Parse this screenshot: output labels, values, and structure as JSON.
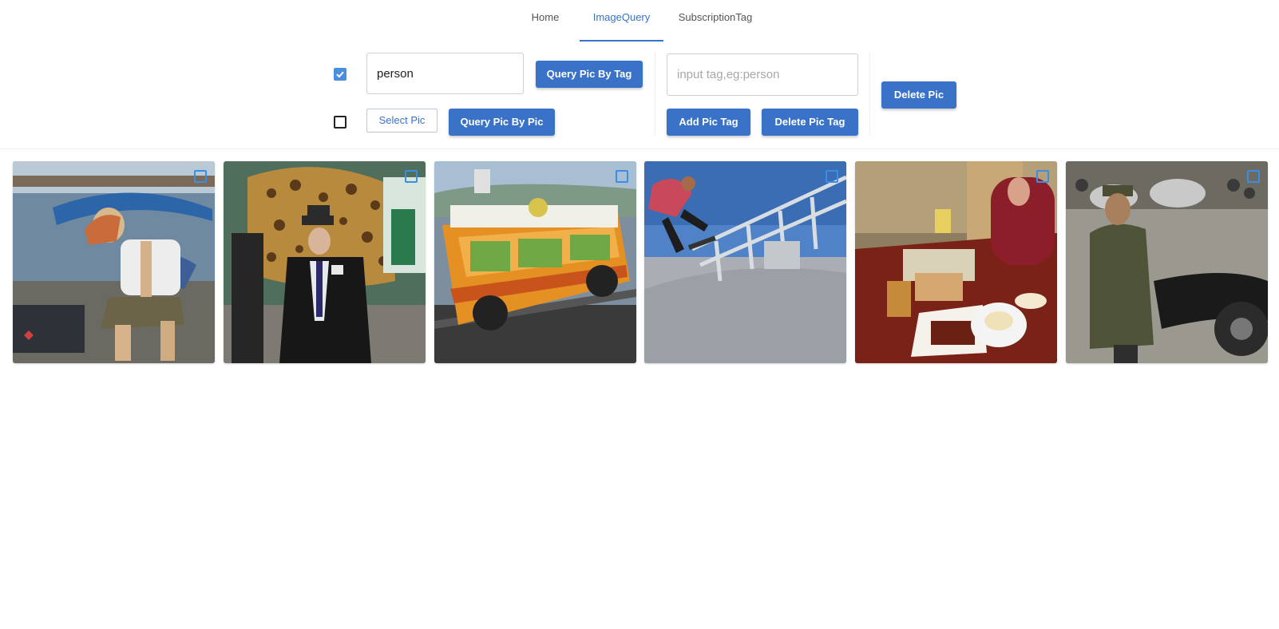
{
  "tabs": [
    {
      "label": "Home",
      "active": false
    },
    {
      "label": "ImageQuery",
      "active": true
    },
    {
      "label": "SubscriptionTag",
      "active": false
    }
  ],
  "query": {
    "tag_checkbox_checked": true,
    "tag_input_value": "person",
    "query_by_tag_label": "Query Pic By Tag",
    "pic_checkbox_checked": false,
    "select_pic_label": "Select Pic",
    "query_by_pic_label": "Query Pic By Pic"
  },
  "tag_edit": {
    "tag_input_placeholder": "input tag,eg:person",
    "add_tag_label": "Add Pic Tag",
    "delete_tag_label": "Delete Pic Tag"
  },
  "delete_pic_label": "Delete Pic",
  "gallery": {
    "images": [
      {
        "subject": "woman-on-boat-dock",
        "selected": false
      },
      {
        "subject": "man-in-suit-with-hat",
        "selected": false
      },
      {
        "subject": "orange-van-with-produce",
        "selected": false
      },
      {
        "subject": "skateboarder-jumping",
        "selected": false
      },
      {
        "subject": "people-at-dinner-table",
        "selected": false
      },
      {
        "subject": "man-with-motorbike",
        "selected": false
      }
    ]
  },
  "colors": {
    "accent": "#3a72c8",
    "checkbox_checked": "#4a8ee0",
    "tile_checkbox": "#3a8ee6"
  }
}
